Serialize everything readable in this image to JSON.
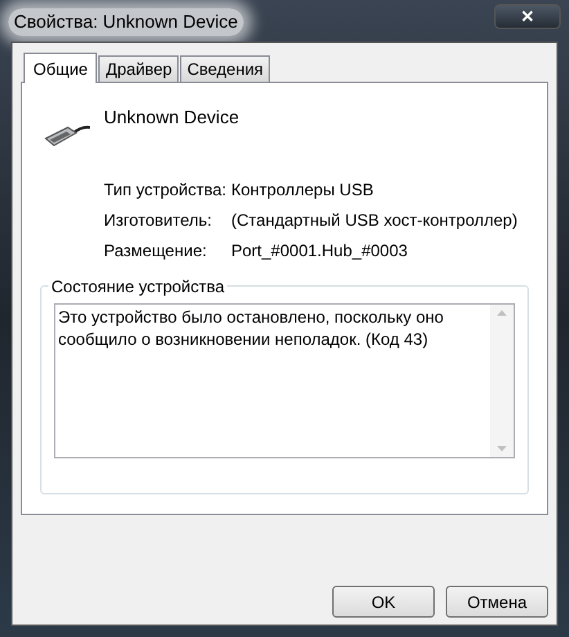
{
  "window": {
    "title": "Свойства: Unknown Device",
    "close": "✕"
  },
  "tabs": [
    {
      "label": "Общие",
      "selected": true
    },
    {
      "label": "Драйвер",
      "selected": false
    },
    {
      "label": "Сведения",
      "selected": false
    }
  ],
  "device": {
    "name": "Unknown Device"
  },
  "properties": [
    {
      "label": "Тип устройства:",
      "value": "Контроллеры USB"
    },
    {
      "label": "Изготовитель:",
      "value": "(Стандартный USB хост-контроллер)"
    },
    {
      "label": "Размещение:",
      "value": "Port_#0001.Hub_#0003"
    }
  ],
  "status": {
    "title": "Состояние устройства",
    "text": "Это устройство было остановлено, поскольку оно сообщило о возникновении неполадок. (Код 43)"
  },
  "buttons": [
    "OK",
    "Отмена"
  ]
}
